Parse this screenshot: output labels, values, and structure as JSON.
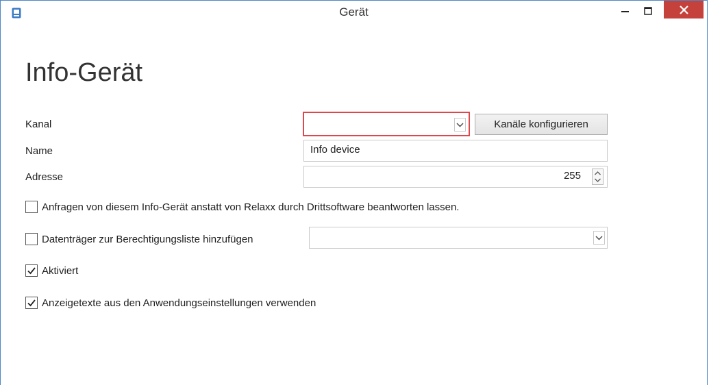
{
  "window": {
    "title": "Gerät"
  },
  "page": {
    "heading": "Info-Gerät"
  },
  "form": {
    "kanal": {
      "label": "Kanal",
      "value": ""
    },
    "configure_button": "Kanäle konfigurieren",
    "name": {
      "label": "Name",
      "value": "Info device"
    },
    "adresse": {
      "label": "Adresse",
      "value": "255"
    },
    "third_party": {
      "label": "Anfragen von diesem Info-Gerät anstatt von Relaxx durch Drittsoftware beantworten lassen.",
      "checked": false
    },
    "datentraeger": {
      "label": "Datenträger zur Berechtigungsliste hinzufügen",
      "checked": false,
      "value": ""
    },
    "aktiviert": {
      "label": "Aktiviert",
      "checked": true
    },
    "anzeigetexte": {
      "label": "Anzeigetexte aus den Anwendungseinstellungen verwenden",
      "checked": true
    }
  },
  "colors": {
    "close_button": "#c4413c",
    "error_border": "#e0474c",
    "app_icon": "#3b7cc4"
  },
  "icons": [
    "app-icon",
    "minimize-icon",
    "maximize-icon",
    "close-icon",
    "chevron-down-icon",
    "spinner-up-icon",
    "spinner-down-icon",
    "checkmark-icon"
  ]
}
